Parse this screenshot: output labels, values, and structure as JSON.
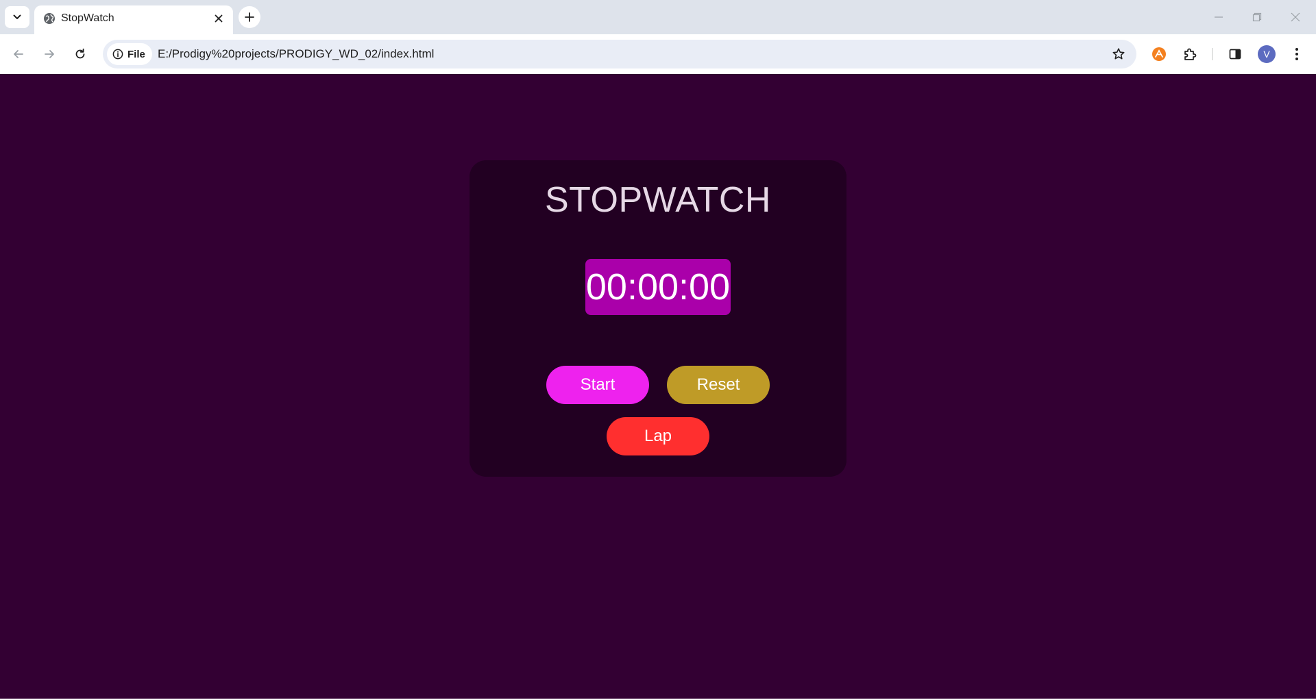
{
  "browser": {
    "tab": {
      "title": "StopWatch",
      "favicon": "globe-icon"
    },
    "omnibox": {
      "site_chip_label": "File",
      "url": "E:/Prodigy%20projects/PRODIGY_WD_02/index.html"
    },
    "profile_initial": "V",
    "icons": {
      "tab_search": "chevron-down-icon",
      "close_tab": "close-icon",
      "new_tab": "plus-icon",
      "back": "arrow-left-icon",
      "forward": "arrow-right-icon",
      "reload": "reload-icon",
      "info": "info-icon",
      "bookmark": "star-icon",
      "extension_orange": "extension-badge-icon",
      "extensions": "puzzle-icon",
      "side_panel": "side-panel-icon",
      "minimize": "minimize-icon",
      "restore": "restore-icon",
      "close_window": "close-window-icon"
    },
    "colors": {
      "tab_strip": "#dee3eb",
      "omnibox": "#e9edf6",
      "avatar": "#5c6bc0",
      "extension_badge": "#f4801f"
    }
  },
  "page": {
    "title": "STOPWATCH",
    "time": "00:00:00",
    "buttons": {
      "start": "Start",
      "reset": "Reset",
      "lap": "Lap"
    },
    "colors": {
      "background": "#330033",
      "card": "#220022",
      "title": "#e6d8e6",
      "time_display": "#aa00aa",
      "start": "#ee22ee",
      "reset": "#bf9b27",
      "lap": "#ff2f2f"
    }
  }
}
